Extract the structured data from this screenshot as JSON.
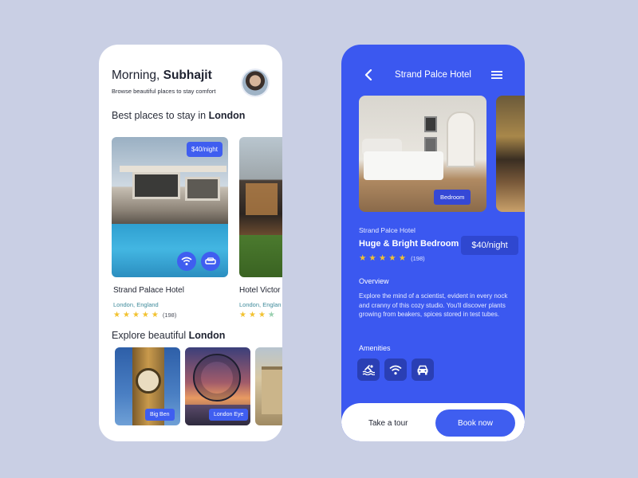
{
  "left": {
    "greeting_prefix": "Morning, ",
    "greeting_name": "Subhajit",
    "subtitle": "Browse beautiful places to stay comfort",
    "best_prefix": "Best places to stay in ",
    "best_city": "London",
    "explore_prefix": "Explore beautiful ",
    "explore_city": "London",
    "hotels": [
      {
        "name": "Strand Palace Hotel",
        "location": "London, England",
        "price": "$40/night",
        "stars": 5,
        "reviews": "(198)"
      },
      {
        "name": "Hotel Victor",
        "location": "London, Englan",
        "stars": 4
      }
    ],
    "places": [
      {
        "label": "Big Ben"
      },
      {
        "label": "London Eye"
      },
      {
        "label": ""
      }
    ]
  },
  "right": {
    "title": "Strand Palce Hotel",
    "room_tag": "Bedroom",
    "hotel_name": "Strand Palce Hotel",
    "room_name": "Huge & Bright Bedroom",
    "price": "$40/night",
    "stars": 5,
    "reviews": "(198)",
    "overview_heading": "Overview",
    "overview_text": "Explore the mind of a scientist, evident in every nock and cranny of this cozy studio. You'll discover plants growing from beakers, spices stored in test tubes.",
    "amenities_heading": "Amenities",
    "amenities": [
      "pool-icon",
      "wifi-icon",
      "car-icon"
    ],
    "tour_label": "Take a tour",
    "book_label": "Book now"
  },
  "colors": {
    "background": "#c9cfe4",
    "accent": "#3f5ef0",
    "panel_blue": "#3b58f0",
    "star": "#f2c230"
  }
}
